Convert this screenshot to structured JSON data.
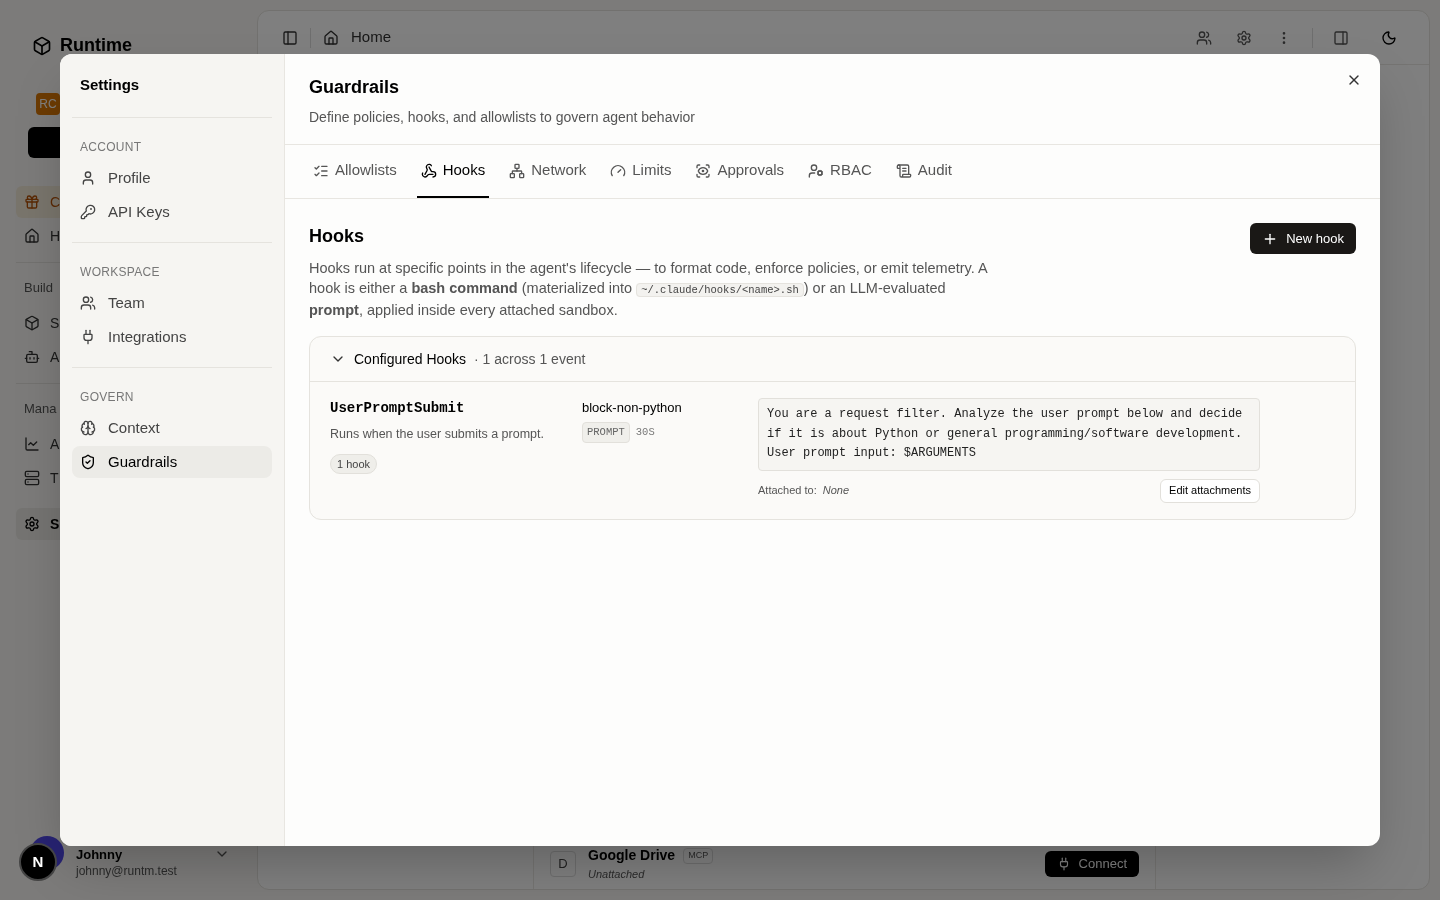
{
  "app": {
    "brand": "Runtime",
    "workspace_badge": "RC",
    "nav": [
      {
        "label": "C",
        "kind": "promo"
      },
      {
        "label": "H",
        "kind": "link",
        "selected": false
      },
      {
        "label": "Build",
        "kind": "heading"
      },
      {
        "label": "S",
        "kind": "link",
        "selected": false
      },
      {
        "label": "A",
        "kind": "link",
        "selected": false
      },
      {
        "label": "Mana",
        "kind": "heading"
      },
      {
        "label": "A",
        "kind": "link",
        "selected": false
      },
      {
        "label": "T",
        "kind": "link",
        "selected": false
      },
      {
        "label": "S",
        "kind": "link",
        "selected": true
      }
    ],
    "user": {
      "name": "Johnny",
      "email": "johnny@runtm.test"
    },
    "breadcrumb": "Home",
    "integration": {
      "initial": "D",
      "name": "Google Drive",
      "badge": "MCP",
      "status": "Unattached",
      "action": "Connect"
    },
    "dev_badge": "N"
  },
  "settings": {
    "title": "Settings",
    "sections": [
      {
        "heading": "ACCOUNT",
        "items": [
          {
            "label": "Profile",
            "selected": false
          },
          {
            "label": "API Keys",
            "selected": false
          }
        ]
      },
      {
        "heading": "WORKSPACE",
        "items": [
          {
            "label": "Team",
            "selected": false
          },
          {
            "label": "Integrations",
            "selected": false
          }
        ]
      },
      {
        "heading": "GOVERN",
        "items": [
          {
            "label": "Context",
            "selected": false
          },
          {
            "label": "Guardrails",
            "selected": true
          }
        ]
      }
    ]
  },
  "page": {
    "title": "Guardrails",
    "subtitle": "Define policies, hooks, and allowlists to govern agent behavior",
    "tabs": [
      {
        "label": "Allowlists",
        "selected": false
      },
      {
        "label": "Hooks",
        "selected": true
      },
      {
        "label": "Network",
        "selected": false
      },
      {
        "label": "Limits",
        "selected": false
      },
      {
        "label": "Approvals",
        "selected": false
      },
      {
        "label": "RBAC",
        "selected": false
      },
      {
        "label": "Audit",
        "selected": false
      }
    ],
    "section": {
      "title": "Hooks",
      "button": "New hook",
      "description": [
        {
          "kind": "text",
          "text": "Hooks run at specific points in the agent's lifecycle — to format code, enforce policies, or emit telemetry. A hook is either a **bash command** (materialized into "
        },
        {
          "kind": "code",
          "text": "~/.claude/hooks/<name>.sh"
        },
        {
          "kind": "text",
          "text": ") or an LLM-evaluated **prompt**, applied inside every attached sandbox."
        }
      ],
      "group": {
        "title": "Configured Hooks",
        "summary": "· 1 across 1 event",
        "expanded": true,
        "events": [
          {
            "name": "UserPromptSubmit",
            "description": "Runs when the user submits a prompt.",
            "count": "1 hook",
            "hooks": [
              {
                "name": "block-non-python",
                "type": "PROMPT",
                "timeout": "30S",
                "prompt": "You are a request filter. Analyze the user prompt below and decide\nif it is about Python or general programming/software development.\nUser prompt input: $ARGUMENTS",
                "attached_label": "Attached to:",
                "attached_value": "None",
                "action": "Edit attachments"
              }
            ]
          }
        ]
      }
    }
  }
}
